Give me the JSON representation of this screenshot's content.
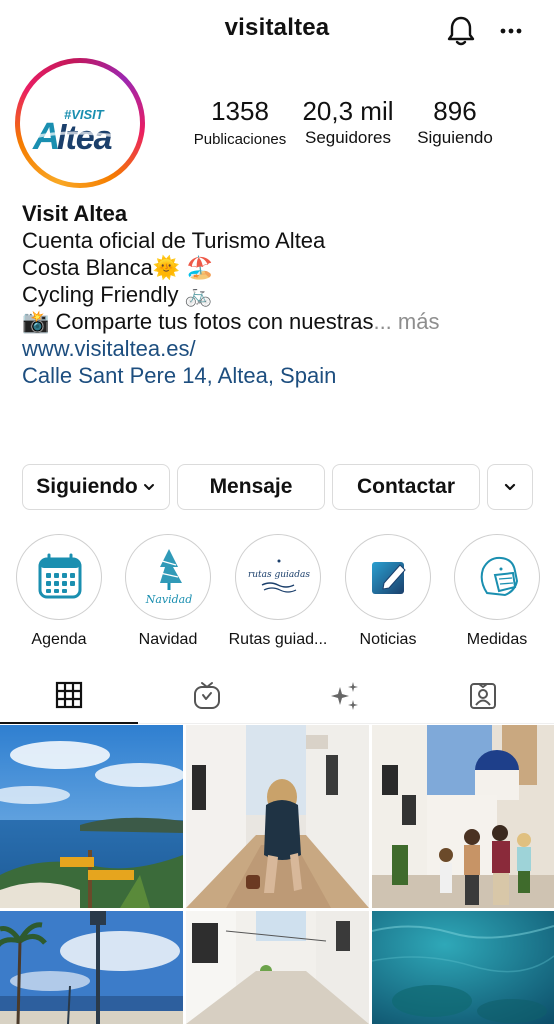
{
  "header": {
    "username": "visitaltea",
    "bell_icon": "bell-icon",
    "more_icon": "more-icon"
  },
  "profile": {
    "avatar_text_top": "#VISIT",
    "avatar_text_main": "Altea",
    "stats": [
      {
        "value": "1358",
        "label": "Publicaciones"
      },
      {
        "value": "20,3 mil",
        "label": "Seguidores"
      },
      {
        "value": "896",
        "label": "Siguiendo"
      }
    ]
  },
  "bio": {
    "name": "Visit Altea",
    "line1": "Cuenta oficial de Turismo Altea",
    "line2": "Costa Blanca🌞 🏖️",
    "line3": "Cycling Friendly 🚲",
    "line4": "📸 Comparte tus fotos con nuestras",
    "more": "... más",
    "website": "www.visitaltea.es/",
    "address": "Calle Sant Pere 14, Altea, Spain"
  },
  "actions": {
    "following": "Siguiendo",
    "message": "Mensaje",
    "contact": "Contactar"
  },
  "highlights": [
    {
      "label": "Agenda",
      "icon": "calendar-icon"
    },
    {
      "label": "Navidad",
      "icon": "christmas-tree-icon",
      "inner_text": "Navidad"
    },
    {
      "label": "Rutas guiad...",
      "icon": "guided-routes-icon",
      "inner_text": "rutas guiadas"
    },
    {
      "label": "Noticias",
      "icon": "news-icon"
    },
    {
      "label": "Medidas",
      "icon": "mask-icon"
    }
  ],
  "tabs": [
    {
      "name": "grid",
      "icon": "grid-icon",
      "active": true
    },
    {
      "name": "igtv",
      "icon": "igtv-icon"
    },
    {
      "name": "guides",
      "icon": "sparkle-icon"
    },
    {
      "name": "tagged",
      "icon": "tagged-icon"
    }
  ],
  "colors": {
    "link": "#1d4e7f",
    "border": "#dbdbdb",
    "brand_teal": "#1a8fb0",
    "brand_dark": "#1b3f6b"
  }
}
